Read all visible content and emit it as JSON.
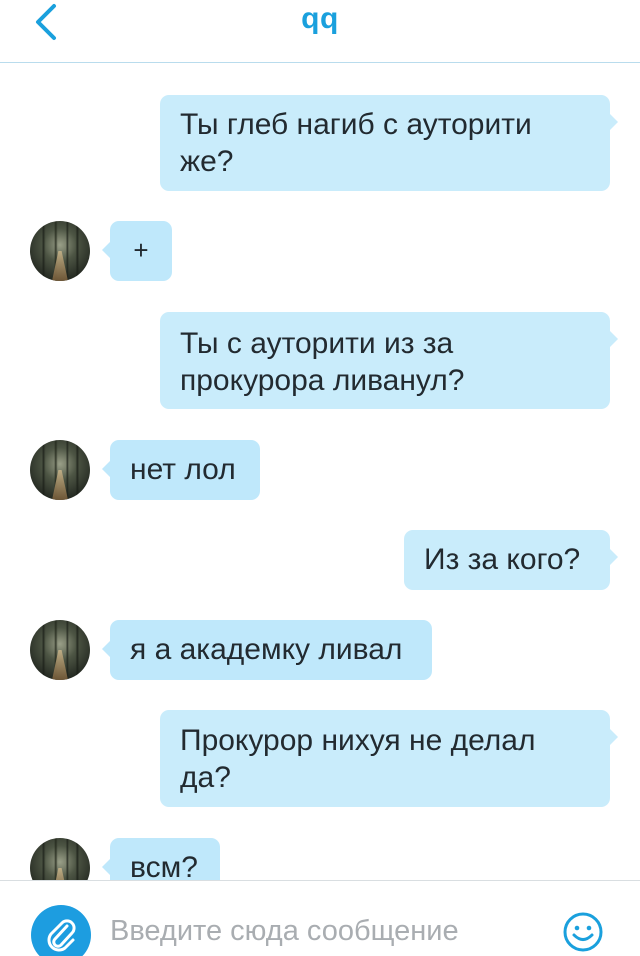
{
  "header": {
    "title": "qq",
    "back_icon": "chevron-left-icon"
  },
  "colors": {
    "accent": "#1aa0dd",
    "bubble_out": "#c9ecfb",
    "bubble_in": "#bfe8fb",
    "placeholder": "#a9adb1"
  },
  "messages": [
    {
      "direction": "out",
      "text": "Ты глеб нагиб с ауторити же?"
    },
    {
      "direction": "in",
      "text": "+"
    },
    {
      "direction": "out",
      "text": "Ты с ауторити из за прокурора ливанул?"
    },
    {
      "direction": "in",
      "text": "нет лол"
    },
    {
      "direction": "out",
      "text": "Из за кого?"
    },
    {
      "direction": "in",
      "text": "я а академку ливал"
    },
    {
      "direction": "out",
      "text": "Прокурор нихуя не делал да?"
    },
    {
      "direction": "in",
      "text": "всм?"
    }
  ],
  "composer": {
    "placeholder": "Введите сюда сообщение",
    "value": "",
    "attach_icon": "paperclip-icon",
    "emoji_icon": "smiley-icon"
  }
}
